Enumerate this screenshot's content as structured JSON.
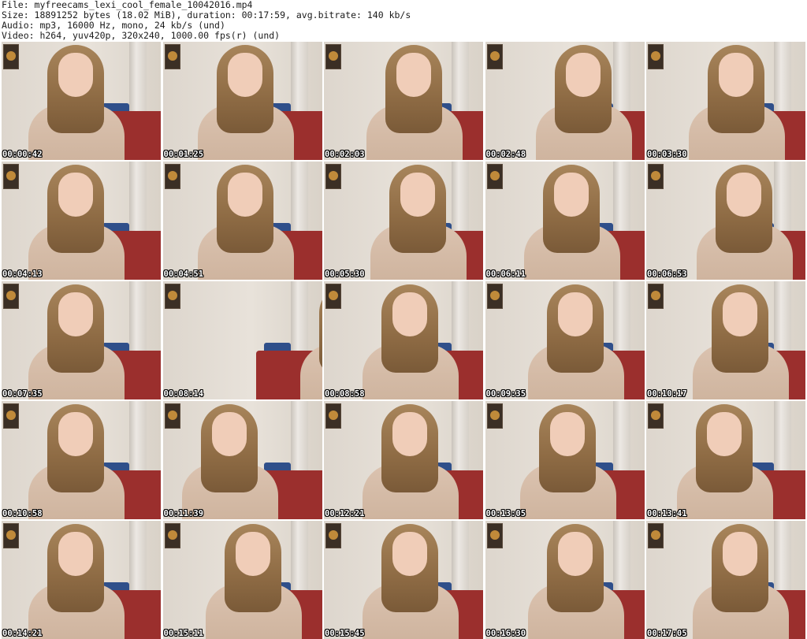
{
  "header": {
    "file_line": "File: myfreecams_lexi_cool_female_10042016.mp4",
    "size_line": "Size: 18891252 bytes (18.02 MiB), duration: 00:17:59, avg.bitrate: 140 kb/s",
    "audio_line": "Audio: mp3, 16000 Hz, mono, 24 kb/s (und)",
    "video_line": "Video: h264, yuv420p, 320x240, 1000.00 fps(r) (und)"
  },
  "thumbnails": [
    {
      "timestamp": "00:00:42"
    },
    {
      "timestamp": "00:01:25"
    },
    {
      "timestamp": "00:02:03"
    },
    {
      "timestamp": "00:02:48"
    },
    {
      "timestamp": "00:03:30"
    },
    {
      "timestamp": "00:04:13"
    },
    {
      "timestamp": "00:04:51"
    },
    {
      "timestamp": "00:05:30"
    },
    {
      "timestamp": "00:06:11"
    },
    {
      "timestamp": "00:06:53"
    },
    {
      "timestamp": "00:07:35"
    },
    {
      "timestamp": "00:08:14"
    },
    {
      "timestamp": "00:08:58"
    },
    {
      "timestamp": "00:09:35"
    },
    {
      "timestamp": "00:10:17"
    },
    {
      "timestamp": "00:10:58"
    },
    {
      "timestamp": "00:11:39"
    },
    {
      "timestamp": "00:12:21"
    },
    {
      "timestamp": "00:13:05"
    },
    {
      "timestamp": "00:13:41"
    },
    {
      "timestamp": "00:14:21"
    },
    {
      "timestamp": "00:15:11"
    },
    {
      "timestamp": "00:15:45"
    },
    {
      "timestamp": "00:16:30"
    },
    {
      "timestamp": "00:17:05"
    }
  ]
}
